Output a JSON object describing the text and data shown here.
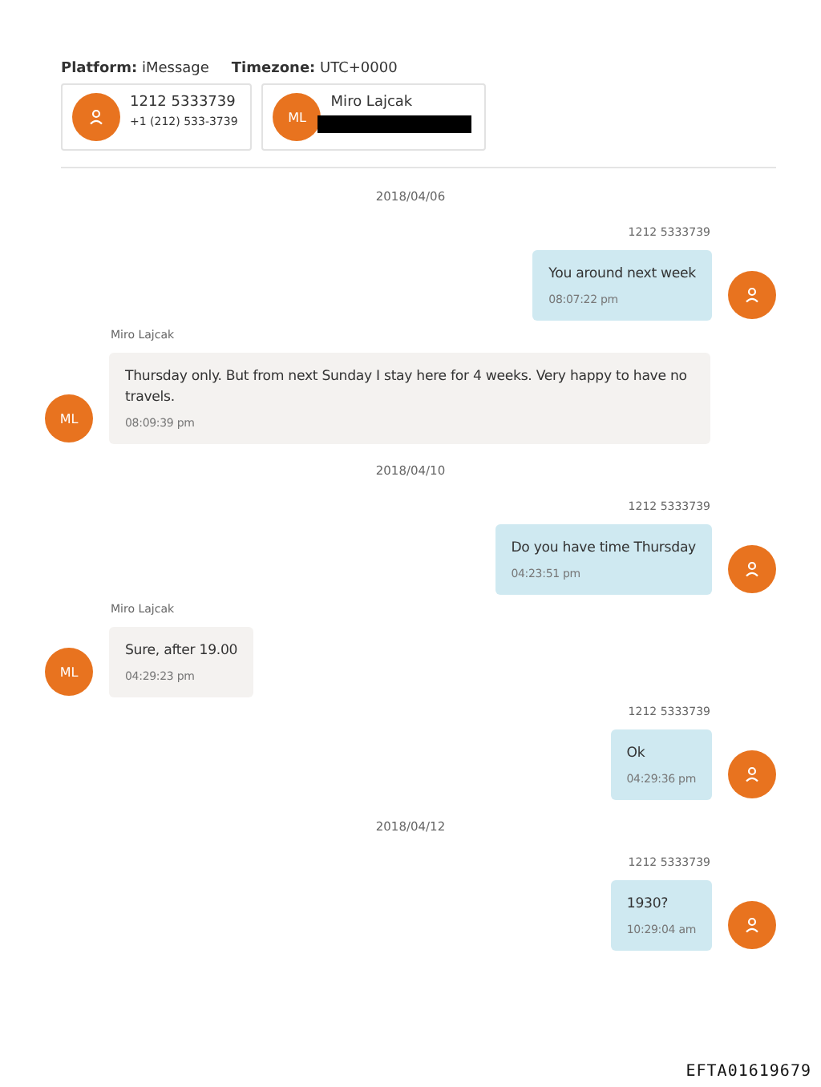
{
  "header": {
    "platform_label": "Platform:",
    "platform": "iMessage",
    "timezone_label": "Timezone:",
    "timezone": "UTC+0000"
  },
  "participants": [
    {
      "kind": "icon",
      "name": "1212 5333739",
      "detail": "+1 (212) 533-3739",
      "redacted": false
    },
    {
      "kind": "initials",
      "initials": "ML",
      "name": "Miro Lajcak",
      "redacted": true
    }
  ],
  "items": [
    {
      "kind": "date",
      "text": "2018/04/06"
    },
    {
      "kind": "outgoing",
      "sender": "1212 5333739",
      "text": "You around next week",
      "time": "08:07:22 pm"
    },
    {
      "kind": "incoming",
      "sender": "Miro Lajcak",
      "initials": "ML",
      "text": "Thursday only. But from next Sunday I stay here for 4 weeks. Very happy to have no travels.",
      "time": "08:09:39 pm"
    },
    {
      "kind": "date",
      "text": "2018/04/10"
    },
    {
      "kind": "outgoing",
      "sender": "1212 5333739",
      "text": "Do you have time Thursday",
      "time": "04:23:51 pm"
    },
    {
      "kind": "incoming",
      "sender": "Miro Lajcak",
      "initials": "ML",
      "text": "Sure, after 19.00",
      "time": "04:29:23 pm"
    },
    {
      "kind": "outgoing",
      "sender": "1212 5333739",
      "text": "Ok",
      "time": "04:29:36 pm"
    },
    {
      "kind": "date",
      "text": "2018/04/12"
    },
    {
      "kind": "outgoing",
      "sender": "1212 5333739",
      "text": "1930?",
      "time": "10:29:04 am"
    }
  ],
  "document_id": "EFTA01619679"
}
